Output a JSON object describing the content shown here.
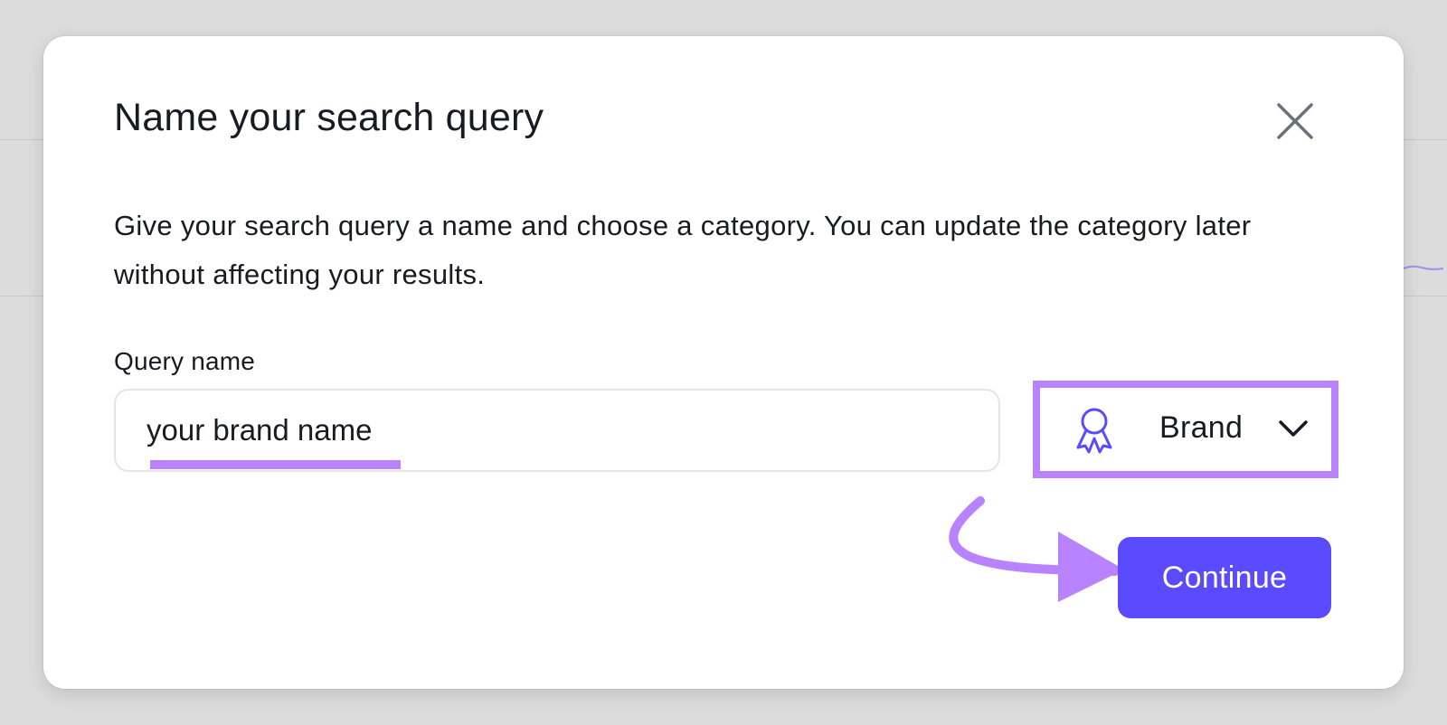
{
  "modal": {
    "title": "Name your search query",
    "description": "Give your search query a name and choose a category. You can update the category later without affecting your results.",
    "close_icon": "close-icon"
  },
  "query": {
    "label": "Query name",
    "value": "your brand name"
  },
  "category": {
    "icon": "award-ribbon-icon",
    "selected": "Brand",
    "dropdown_icon": "chevron-down-icon"
  },
  "actions": {
    "continue_label": "Continue"
  },
  "colors": {
    "accent": "#5b4bff",
    "highlight": "#b983ff",
    "text": "#191b23",
    "overlay": "#dcdcdc"
  }
}
